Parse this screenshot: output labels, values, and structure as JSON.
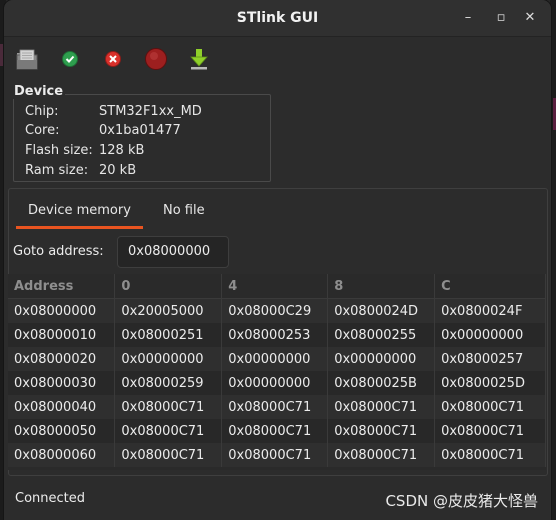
{
  "window": {
    "title": "STlink GUI"
  },
  "window_controls": {
    "minimize": "–",
    "maximize": "▫",
    "close": "✕"
  },
  "toolbar": {
    "items": [
      {
        "icon": "open-file-icon"
      },
      {
        "icon": "connect-icon",
        "color": "#2e9e4e"
      },
      {
        "icon": "disconnect-icon",
        "color": "#d9302b"
      },
      {
        "icon": "stop-icon",
        "color": "#9d1f1f"
      },
      {
        "icon": "flash-download-icon",
        "color": "#8fcf2a"
      }
    ]
  },
  "device": {
    "title": "Device",
    "rows": [
      {
        "label": "Chip:",
        "value": "STM32F1xx_MD"
      },
      {
        "label": "Core:",
        "value": "0x1ba01477"
      },
      {
        "label": "Flash size:",
        "value": "128 kB"
      },
      {
        "label": "Ram size:",
        "value": "20 kB"
      }
    ]
  },
  "tabs": [
    {
      "label": "Device memory",
      "active": true
    },
    {
      "label": "No file",
      "active": false
    }
  ],
  "goto": {
    "label": "Goto address:",
    "value": "0x08000000"
  },
  "memory_table": {
    "headers": [
      "Address",
      "0",
      "4",
      "8",
      "C"
    ],
    "rows": [
      [
        "0x08000000",
        "0x20005000",
        "0x08000C29",
        "0x0800024D",
        "0x0800024F"
      ],
      [
        "0x08000010",
        "0x08000251",
        "0x08000253",
        "0x08000255",
        "0x00000000"
      ],
      [
        "0x08000020",
        "0x00000000",
        "0x00000000",
        "0x00000000",
        "0x08000257"
      ],
      [
        "0x08000030",
        "0x08000259",
        "0x00000000",
        "0x0800025B",
        "0x0800025D"
      ],
      [
        "0x08000040",
        "0x08000C71",
        "0x08000C71",
        "0x08000C71",
        "0x08000C71"
      ],
      [
        "0x08000050",
        "0x08000C71",
        "0x08000C71",
        "0x08000C71",
        "0x08000C71"
      ],
      [
        "0x08000060",
        "0x08000C71",
        "0x08000C71",
        "0x08000C71",
        "0x08000C71"
      ]
    ]
  },
  "status": {
    "text": "Connected"
  },
  "watermark": "CSDN @皮皮猪大怪兽",
  "colors": {
    "accent": "#e95420",
    "background": "#2c2c2c"
  }
}
